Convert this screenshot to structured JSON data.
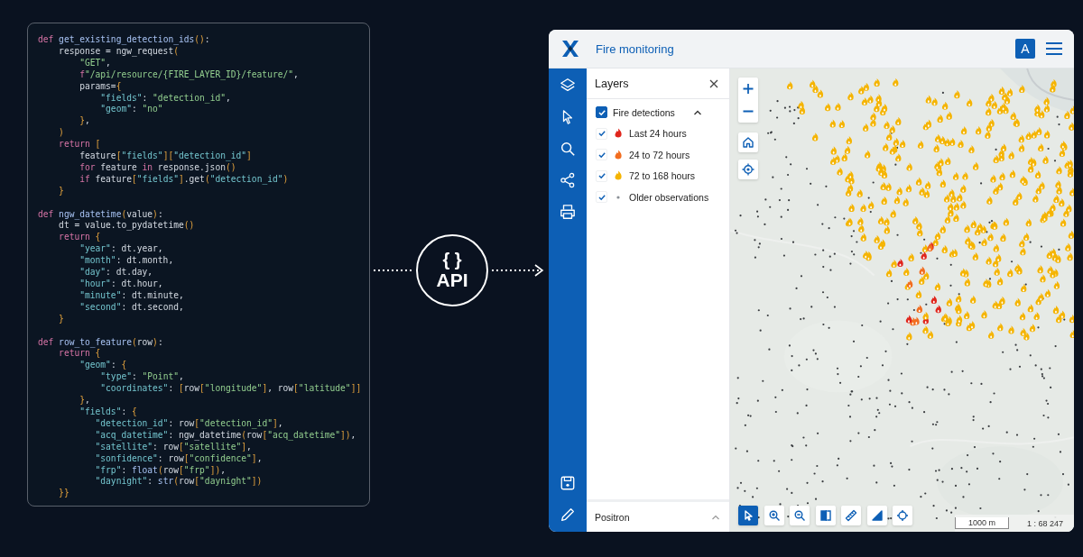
{
  "code": {
    "lines": [
      {
        "tokens": [
          {
            "kind": "kw",
            "text": "def "
          },
          {
            "kind": "fn",
            "text": "get_existing_detection_ids"
          },
          {
            "kind": "br",
            "text": "()"
          },
          {
            "kind": "txt",
            "text": ":"
          }
        ]
      },
      {
        "tokens": [
          {
            "kind": "txt",
            "text": "    response = ngw_request"
          },
          {
            "kind": "br",
            "text": "("
          }
        ]
      },
      {
        "tokens": [
          {
            "kind": "str",
            "text": "        \"GET\""
          },
          {
            "kind": "txt",
            "text": ","
          }
        ]
      },
      {
        "tokens": [
          {
            "kind": "kw",
            "text": "        f"
          },
          {
            "kind": "str",
            "text": "\"/api/resource/{FIRE_LAYER_ID}/feature/\""
          },
          {
            "kind": "txt",
            "text": ","
          }
        ]
      },
      {
        "tokens": [
          {
            "kind": "txt",
            "text": "        params="
          },
          {
            "kind": "br",
            "text": "{"
          }
        ]
      },
      {
        "tokens": [
          {
            "kind": "key",
            "text": "            \"fields\""
          },
          {
            "kind": "txt",
            "text": ": "
          },
          {
            "kind": "str",
            "text": "\"detection_id\""
          },
          {
            "kind": "txt",
            "text": ","
          }
        ]
      },
      {
        "tokens": [
          {
            "kind": "key",
            "text": "            \"geom\""
          },
          {
            "kind": "txt",
            "text": ": "
          },
          {
            "kind": "str",
            "text": "\"no\""
          }
        ]
      },
      {
        "tokens": [
          {
            "kind": "br",
            "text": "        }"
          },
          {
            "kind": "txt",
            "text": ","
          }
        ]
      },
      {
        "tokens": [
          {
            "kind": "br",
            "text": "    )"
          }
        ]
      },
      {
        "tokens": [
          {
            "kind": "kw",
            "text": "    return "
          },
          {
            "kind": "br",
            "text": "["
          }
        ]
      },
      {
        "tokens": [
          {
            "kind": "txt",
            "text": "        feature"
          },
          {
            "kind": "br",
            "text": "["
          },
          {
            "kind": "key",
            "text": "\"fields\""
          },
          {
            "kind": "br",
            "text": "]["
          },
          {
            "kind": "key",
            "text": "\"detection_id\""
          },
          {
            "kind": "br",
            "text": "]"
          }
        ]
      },
      {
        "tokens": [
          {
            "kind": "kw",
            "text": "        for "
          },
          {
            "kind": "txt",
            "text": "feature "
          },
          {
            "kind": "kw",
            "text": "in "
          },
          {
            "kind": "txt",
            "text": "response.json"
          },
          {
            "kind": "br",
            "text": "()"
          }
        ]
      },
      {
        "tokens": [
          {
            "kind": "kw",
            "text": "        if "
          },
          {
            "kind": "txt",
            "text": "feature"
          },
          {
            "kind": "br",
            "text": "["
          },
          {
            "kind": "key",
            "text": "\"fields\""
          },
          {
            "kind": "br",
            "text": "]"
          },
          {
            "kind": "txt",
            "text": ".get"
          },
          {
            "kind": "br",
            "text": "("
          },
          {
            "kind": "key",
            "text": "\"detection_id\""
          },
          {
            "kind": "br",
            "text": ")"
          }
        ]
      },
      {
        "tokens": [
          {
            "kind": "br",
            "text": "    }"
          }
        ]
      },
      {
        "blank_before": true,
        "tokens": [
          {
            "kind": "kw",
            "text": "def "
          },
          {
            "kind": "fn",
            "text": "ngw_datetime"
          },
          {
            "kind": "br",
            "text": "("
          },
          {
            "kind": "txt",
            "text": "value"
          },
          {
            "kind": "br",
            "text": ")"
          },
          {
            "kind": "txt",
            "text": ":"
          }
        ]
      },
      {
        "tokens": [
          {
            "kind": "txt",
            "text": "    dt = value.to_pydatetime"
          },
          {
            "kind": "br",
            "text": "()"
          }
        ]
      },
      {
        "tokens": [
          {
            "kind": "kw",
            "text": "    return "
          },
          {
            "kind": "br",
            "text": "{"
          }
        ]
      },
      {
        "tokens": [
          {
            "kind": "key",
            "text": "        \"year\""
          },
          {
            "kind": "txt",
            "text": ": dt.year,"
          }
        ]
      },
      {
        "tokens": [
          {
            "kind": "key",
            "text": "        \"month\""
          },
          {
            "kind": "txt",
            "text": ": dt.month,"
          }
        ]
      },
      {
        "tokens": [
          {
            "kind": "key",
            "text": "        \"day\""
          },
          {
            "kind": "txt",
            "text": ": dt.day,"
          }
        ]
      },
      {
        "tokens": [
          {
            "kind": "key",
            "text": "        \"hour\""
          },
          {
            "kind": "txt",
            "text": ": dt.hour,"
          }
        ]
      },
      {
        "tokens": [
          {
            "kind": "key",
            "text": "        \"minute\""
          },
          {
            "kind": "txt",
            "text": ": dt.minute,"
          }
        ]
      },
      {
        "tokens": [
          {
            "kind": "key",
            "text": "        \"second\""
          },
          {
            "kind": "txt",
            "text": ": dt.second,"
          }
        ]
      },
      {
        "tokens": [
          {
            "kind": "br",
            "text": "    }"
          }
        ]
      },
      {
        "blank_before": true,
        "tokens": [
          {
            "kind": "kw",
            "text": "def "
          },
          {
            "kind": "fn",
            "text": "row_to_feature"
          },
          {
            "kind": "br",
            "text": "("
          },
          {
            "kind": "txt",
            "text": "row"
          },
          {
            "kind": "br",
            "text": ")"
          },
          {
            "kind": "txt",
            "text": ":"
          }
        ]
      },
      {
        "tokens": [
          {
            "kind": "kw",
            "text": "    return "
          },
          {
            "kind": "br",
            "text": "{"
          }
        ]
      },
      {
        "tokens": [
          {
            "kind": "key",
            "text": "        \"geom\""
          },
          {
            "kind": "txt",
            "text": ": "
          },
          {
            "kind": "br",
            "text": "{"
          }
        ]
      },
      {
        "tokens": [
          {
            "kind": "key",
            "text": "            \"type\""
          },
          {
            "kind": "txt",
            "text": ": "
          },
          {
            "kind": "str",
            "text": "\"Point\""
          },
          {
            "kind": "txt",
            "text": ","
          }
        ]
      },
      {
        "tokens": [
          {
            "kind": "key",
            "text": "            \"coordinates\""
          },
          {
            "kind": "txt",
            "text": ": "
          },
          {
            "kind": "br",
            "text": "["
          },
          {
            "kind": "txt",
            "text": "row"
          },
          {
            "kind": "br",
            "text": "["
          },
          {
            "kind": "str",
            "text": "\"longitude\""
          },
          {
            "kind": "br",
            "text": "]"
          },
          {
            "kind": "txt",
            "text": ", row"
          },
          {
            "kind": "br",
            "text": "["
          },
          {
            "kind": "str",
            "text": "\"latitude\""
          },
          {
            "kind": "br",
            "text": "]]"
          }
        ]
      },
      {
        "tokens": [
          {
            "kind": "br",
            "text": "        }"
          },
          {
            "kind": "txt",
            "text": ","
          }
        ]
      },
      {
        "tokens": [
          {
            "kind": "key",
            "text": "        \"fields\""
          },
          {
            "kind": "txt",
            "text": ": "
          },
          {
            "kind": "br",
            "text": "{"
          }
        ]
      },
      {
        "tokens": [
          {
            "kind": "key",
            "text": "           \"detection_id\""
          },
          {
            "kind": "txt",
            "text": ": row"
          },
          {
            "kind": "br",
            "text": "["
          },
          {
            "kind": "str",
            "text": "\"detection_id\""
          },
          {
            "kind": "br",
            "text": "]"
          },
          {
            "kind": "txt",
            "text": ","
          }
        ]
      },
      {
        "tokens": [
          {
            "kind": "key",
            "text": "           \"acq_datetime\""
          },
          {
            "kind": "txt",
            "text": ": ngw_datetime"
          },
          {
            "kind": "br",
            "text": "("
          },
          {
            "kind": "txt",
            "text": "row"
          },
          {
            "kind": "br",
            "text": "["
          },
          {
            "kind": "str",
            "text": "\"acq_datetime\""
          },
          {
            "kind": "br",
            "text": "])"
          },
          {
            "kind": "txt",
            "text": ","
          }
        ]
      },
      {
        "tokens": [
          {
            "kind": "key",
            "text": "           \"satellite\""
          },
          {
            "kind": "txt",
            "text": ": row"
          },
          {
            "kind": "br",
            "text": "["
          },
          {
            "kind": "str",
            "text": "\"satellite\""
          },
          {
            "kind": "br",
            "text": "]"
          },
          {
            "kind": "txt",
            "text": ","
          }
        ]
      },
      {
        "tokens": [
          {
            "kind": "key",
            "text": "           \"sonfidence\""
          },
          {
            "kind": "txt",
            "text": ": row"
          },
          {
            "kind": "br",
            "text": "["
          },
          {
            "kind": "str",
            "text": "\"confidence\""
          },
          {
            "kind": "br",
            "text": "]"
          },
          {
            "kind": "txt",
            "text": ","
          }
        ]
      },
      {
        "tokens": [
          {
            "kind": "key",
            "text": "           \"frp\""
          },
          {
            "kind": "txt",
            "text": ": "
          },
          {
            "kind": "fn",
            "text": "float"
          },
          {
            "kind": "br",
            "text": "("
          },
          {
            "kind": "txt",
            "text": "row"
          },
          {
            "kind": "br",
            "text": "["
          },
          {
            "kind": "str",
            "text": "\"frp\""
          },
          {
            "kind": "br",
            "text": "])"
          },
          {
            "kind": "txt",
            "text": ","
          }
        ]
      },
      {
        "tokens": [
          {
            "kind": "key",
            "text": "           \"daynight\""
          },
          {
            "kind": "txt",
            "text": ": "
          },
          {
            "kind": "fn",
            "text": "str"
          },
          {
            "kind": "br",
            "text": "("
          },
          {
            "kind": "txt",
            "text": "row"
          },
          {
            "kind": "br",
            "text": "["
          },
          {
            "kind": "str",
            "text": "\"daynight\""
          },
          {
            "kind": "br",
            "text": "])"
          }
        ]
      },
      {
        "tokens": [
          {
            "kind": "br",
            "text": "    }}"
          }
        ]
      }
    ]
  },
  "connector": {
    "braces": "{ }",
    "label": "API"
  },
  "app": {
    "title": "Fire monitoring",
    "avatar": "A",
    "layers_panel": {
      "title": "Layers",
      "groups": [
        {
          "label": "Fire detections",
          "checked": true,
          "expanded": true,
          "children": [
            {
              "label": "Last 24 hours",
              "checked": true,
              "kind": "flame",
              "color": "#e0261c"
            },
            {
              "label": "24 to 72 hours",
              "checked": true,
              "kind": "flame",
              "color": "#f26d1f"
            },
            {
              "label": "72 to 168 hours",
              "checked": true,
              "kind": "flame",
              "color": "#f5b400"
            },
            {
              "label": "Older observations",
              "checked": true,
              "kind": "dot",
              "color": "#8a8f96"
            }
          ]
        }
      ],
      "basemap": {
        "label": "Positron",
        "expanded": false
      }
    },
    "toolbar": [
      {
        "kind": "select",
        "selected": true
      },
      {
        "kind": "zoom-in",
        "selected": false
      },
      {
        "kind": "zoom-out",
        "selected": false
      },
      {
        "kind": "swipe",
        "selected": false
      },
      {
        "kind": "ruler",
        "selected": false
      },
      {
        "kind": "angle",
        "selected": false
      },
      {
        "kind": "locate",
        "selected": false
      }
    ],
    "scale": {
      "bar": "1000 m",
      "ratio": "1 : 68 247"
    }
  }
}
